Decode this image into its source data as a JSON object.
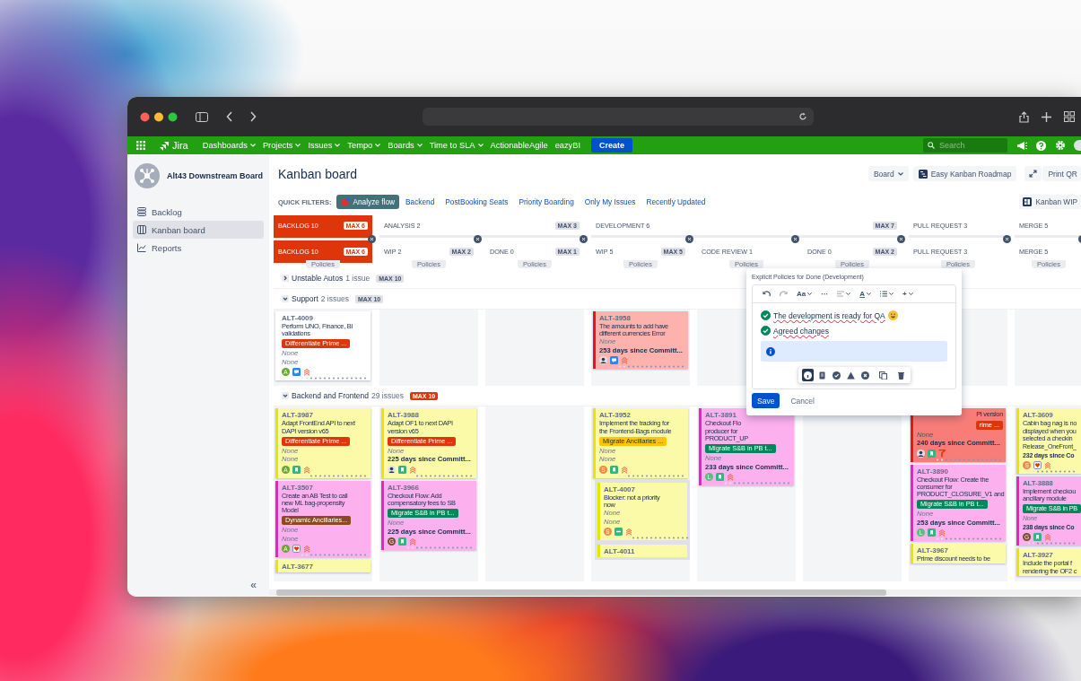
{
  "nav": {
    "logo": "Jira",
    "items": [
      {
        "label": "Dashboards",
        "dropdown": true
      },
      {
        "label": "Projects",
        "dropdown": true
      },
      {
        "label": "Issues",
        "dropdown": true
      },
      {
        "label": "Tempo",
        "dropdown": true
      },
      {
        "label": "Boards",
        "dropdown": true
      },
      {
        "label": "Time to SLA",
        "dropdown": true
      },
      {
        "label": "ActionableAgile",
        "dropdown": false
      },
      {
        "label": "eazyBI",
        "dropdown": false
      }
    ],
    "create": "Create",
    "search": {
      "placeholder": "Search"
    }
  },
  "sidebar": {
    "board_name": "Alt43 Downstream Board",
    "items": [
      {
        "label": "Backlog",
        "selected": false
      },
      {
        "label": "Kanban board",
        "selected": true
      },
      {
        "label": "Reports",
        "selected": false
      }
    ],
    "collapse": "«"
  },
  "header": {
    "title": "Kanban board",
    "buttons": [
      {
        "kind": "dropdown",
        "label": "Board"
      },
      {
        "kind": "roadmap",
        "label": "Easy Kanban Roadmap"
      },
      {
        "kind": "expand"
      },
      {
        "kind": "plain",
        "label": "Print QR"
      }
    ],
    "wip_button": "Kanban WIP"
  },
  "quick_filters": {
    "label": "QUICK FILTERS:",
    "items": [
      {
        "label": "Analyze flow",
        "icon": true,
        "selected": true
      },
      {
        "label": "Backend",
        "selected": false
      },
      {
        "label": "PostBooking Seats",
        "selected": false
      },
      {
        "label": "Priority Boarding",
        "selected": false
      },
      {
        "label": "Only My Issues",
        "selected": false
      },
      {
        "label": "Recently Updated",
        "selected": false
      }
    ]
  },
  "column_groups": [
    {
      "name": "BACKLOG 10",
      "max": "MAX 6",
      "over": true,
      "columns": [
        {
          "name": "BACKLOG 10",
          "max": "MAX 6",
          "over": true,
          "policies": "Policies"
        }
      ]
    },
    {
      "name": "ANALYSIS 2",
      "max": "MAX 3",
      "over": false,
      "columns": [
        {
          "name": "WIP 2",
          "max": "MAX 2",
          "over": false,
          "policies": "Policies"
        },
        {
          "name": "DONE 0",
          "max": "MAX 1",
          "over": false,
          "policies": "Policies"
        }
      ]
    },
    {
      "name": "DEVELOPMENT 6",
      "max": "MAX 7",
      "over": false,
      "columns": [
        {
          "name": "WIP 5",
          "max": "MAX 5",
          "over": false,
          "policies": "Policies"
        },
        {
          "name": "CODE REVIEW 1",
          "over": false,
          "policies": "Policies"
        },
        {
          "name": "DONE 0",
          "max": "MAX 2",
          "over": false,
          "policies": "Policies"
        }
      ]
    },
    {
      "name": "PULL REQUEST 3",
      "over": false,
      "columns": [
        {
          "name": "PULL REQUEST 3",
          "over": false,
          "policies": "Policies"
        }
      ]
    },
    {
      "name": "MERGE 5",
      "over": false,
      "columns": [
        {
          "name": "MERGE 5",
          "over": false,
          "policies": "Policies"
        }
      ]
    }
  ],
  "swimlanes": [
    {
      "title": "Unstable Autos",
      "count": "1 issue",
      "max": "MAX 10",
      "over": false,
      "expanded": false
    },
    {
      "title": "Support",
      "count": "2 issues",
      "max": "MAX 10",
      "over": false,
      "expanded": true,
      "cells": [
        {
          "cards": [
            {
              "id": "ALT-4009",
              "color": "#ffffff",
              "stripe": {
                "color": "#ffffff"
              },
              "summary": [
                "Perform UNO, Finance, BI",
                "validations"
              ],
              "epic": {
                "text": "Differentiate Prime ...",
                "color": "#de350b"
              },
              "fields": [
                {
                  "kind": "none",
                  "text": "None"
                },
                {
                  "kind": "none",
                  "text": "None"
                }
              ],
              "avatar": {
                "kind": "letter",
                "letter": "A",
                "color": "#6aa832"
              },
              "type": {
                "kind": "task"
              },
              "priority": {
                "kind": "highest"
              }
            }
          ]
        },
        {},
        {},
        {
          "cards": [
            {
              "id": "ALT-3958",
              "color": "#fdb2ad",
              "stripe": {
                "color": "#e8161b"
              },
              "summary": [
                "The amounts to add have",
                "different currencies Error"
              ],
              "fields": [
                {
                  "kind": "none",
                  "text": "None"
                },
                {
                  "kind": "days",
                  "text": "253 days since Committ..."
                }
              ],
              "avatar": {
                "kind": "photo"
              },
              "type": {
                "kind": "task"
              },
              "priority": {
                "kind": "highest"
              }
            }
          ]
        },
        {},
        {},
        {},
        {}
      ]
    },
    {
      "title": "Backend and Frontend",
      "count": "29 issues",
      "max": "MAX 10",
      "over": true,
      "expanded": true,
      "cells": [
        {
          "cards": [
            {
              "id": "ALT-3987",
              "color": "#fbfaa9",
              "stripe": {
                "color": "#e6e600"
              },
              "summary": [
                "Adapt FrontEnd API to next",
                "DAPI version v65"
              ],
              "epic": {
                "text": "Differentiate Prime ...",
                "color": "#de350b"
              },
              "fields": [
                {
                  "kind": "none",
                  "text": "None"
                },
                {
                  "kind": "none",
                  "text": "None"
                }
              ],
              "avatar": {
                "kind": "letter",
                "letter": "A",
                "color": "#6aa832"
              },
              "type": {
                "kind": "story"
              },
              "priority": {
                "kind": "highest"
              }
            },
            {
              "id": "ALT-3507",
              "color": "#fdb0ee",
              "stripe": {
                "color": "#ee1fc8"
              },
              "summary": [
                "Create an AB Test to call",
                "new ML bag-propensity",
                "Model"
              ],
              "epic": {
                "text": "Dynamic Ancillaries...",
                "color": "#8b4a1f"
              },
              "fields": [
                {
                  "kind": "none",
                  "text": "None"
                },
                {
                  "kind": "none",
                  "text": "None"
                }
              ],
              "avatar": {
                "kind": "letter",
                "letter": "A",
                "color": "#6aa832"
              },
              "type": {
                "kind": "bug"
              },
              "priority": {
                "kind": "highest"
              }
            },
            {
              "id": "ALT-3677",
              "color": "#fbfaa9",
              "stripe": {
                "color": "#e6e600"
              }
            }
          ]
        },
        {
          "cards": [
            {
              "id": "ALT-3988",
              "color": "#fbfaa9",
              "stripe": {
                "color": "#e6e600"
              },
              "summary": [
                "Adapt OF1 to next DAPI",
                "version v65"
              ],
              "epic": {
                "text": "Differentiate Prime ...",
                "color": "#de350b"
              },
              "fields": [
                {
                  "kind": "none",
                  "text": "None"
                },
                {
                  "kind": "days",
                  "text": "225 days since Committ..."
                }
              ],
              "avatar": {
                "kind": "photo"
              },
              "type": {
                "kind": "story"
              },
              "priority": {
                "kind": "highest"
              }
            },
            {
              "id": "ALT-3966",
              "color": "#fdb0ee",
              "stripe": {
                "color": "#ee1fc8"
              },
              "summary": [
                "Checkout Flow: Add",
                "compensatory fees to SB"
              ],
              "epic": {
                "text": "Migrate S&B in PB t...",
                "color": "#00875a"
              },
              "fields": [
                {
                  "kind": "none",
                  "text": "None"
                },
                {
                  "kind": "days",
                  "text": "225 days since Committ..."
                }
              ],
              "avatar": {
                "kind": "letter",
                "letter": "G",
                "color": "#7b4a2c"
              },
              "type": {
                "kind": "story"
              },
              "priority": {
                "kind": "highest"
              }
            }
          ]
        },
        {},
        {
          "cards": [
            {
              "id": "ALT-3952",
              "color": "#fbfaa9",
              "stripe": {
                "color": "#e6e600"
              },
              "summary": [
                "Implement the tracking for",
                "the Frontend-Bags module"
              ],
              "epic": {
                "text": "Migrate Ancillaries ...",
                "color": "#ffc400"
              },
              "fields": [
                {
                  "kind": "none",
                  "text": "None"
                },
                {
                  "kind": "none",
                  "text": "None"
                }
              ],
              "avatar": {
                "kind": "letter",
                "letter": "S",
                "color": "#f08a3c"
              },
              "type": {
                "kind": "story"
              },
              "priority": {
                "kind": "highest"
              }
            },
            {
              "id": "ALT-4007",
              "inset": true,
              "color": "#fbfaa9",
              "stripe": {
                "color": "#e6e600"
              },
              "summary": [
                "Blocker: not a priority",
                "now"
              ],
              "fields": [
                {
                  "kind": "none",
                  "text": "None"
                },
                {
                  "kind": "none",
                  "text": "None"
                }
              ],
              "avatar": {
                "kind": "letter",
                "letter": "S",
                "color": "#f08a3c"
              },
              "type": {
                "kind": "blocker"
              },
              "priority": {
                "kind": "highest"
              }
            },
            {
              "id": "ALT-4011",
              "inset": true,
              "color": "#fbfaa9",
              "stripe": {
                "color": "#e6e600"
              }
            }
          ]
        },
        {
          "cards": [
            {
              "id": "ALT-3891",
              "color": "#fdb0ee",
              "stripe": {
                "color": "#ee1fc8"
              },
              "summary": [
                "Checkout Flo",
                "producer for",
                "PRODUCT_UP"
              ],
              "epic": {
                "text": "Migrate S&B in PB t...",
                "color": "#00875a"
              },
              "fields": [
                {
                  "kind": "none",
                  "text": "None"
                },
                {
                  "kind": "days",
                  "text": "233 days since Committ..."
                }
              ],
              "avatar": {
                "kind": "letter",
                "letter": "L",
                "color": "#5bbf7a"
              },
              "type": {
                "kind": "story"
              },
              "priority": {
                "kind": "highest"
              }
            }
          ]
        },
        {},
        {
          "cards": [
            {
              "covered": true,
              "color": "#f87d78",
              "stripe": {
                "color": "#e8161b"
              },
              "summary": [
                "PI version"
              ],
              "epic": {
                "text": "rime ...",
                "color": "#de350b"
              },
              "fields": [
                {
                  "kind": "none",
                  "text": "None"
                },
                {
                  "kind": "days",
                  "text": "240 days since Committ..."
                }
              ],
              "avatar": {
                "kind": "photo"
              },
              "type": {
                "kind": "story"
              },
              "priority": {
                "kind": "flag"
              }
            },
            {
              "id": "ALT-3890",
              "color": "#fdb0ee",
              "stripe": {
                "color": "#ee1fc8"
              },
              "summary": [
                "Checkout Flow: Create the",
                "consumer for",
                "PRODUCT_CLOSURE_V1 and"
              ],
              "epic": {
                "text": "Migrate S&B in PB t...",
                "color": "#00875a"
              },
              "fields": [
                {
                  "kind": "none",
                  "text": "None"
                },
                {
                  "kind": "days",
                  "text": "253 days since Committ..."
                }
              ],
              "avatar": {
                "kind": "letter",
                "letter": "L",
                "color": "#5bbf7a"
              },
              "type": {
                "kind": "story"
              },
              "priority": {
                "kind": "highest"
              }
            },
            {
              "id": "ALT-3967",
              "color": "#fbfaa9",
              "stripe": {
                "color": "#e6e600"
              },
              "summary": [
                "Prime discount needs to be"
              ]
            }
          ]
        },
        {
          "cards": [
            {
              "id": "ALT-3609",
              "color": "#fbfaa9",
              "stripe": {
                "color": "#e6e600"
              },
              "summary": [
                "Cabin bag nag is no",
                "displayed when you",
                "selected a checkin"
              ],
              "fields": [
                {
                  "kind": "plain",
                  "text": "Release_OneFront_"
                },
                {
                  "kind": "days",
                  "text": "232 days since Co"
                }
              ],
              "avatar": {
                "kind": "letter",
                "letter": "S",
                "color": "#f08a3c"
              },
              "type": {
                "kind": "bug"
              },
              "priority": {
                "kind": "highest"
              }
            },
            {
              "id": "ALT-3888",
              "color": "#fdb0ee",
              "stripe": {
                "color": "#ee1fc8"
              },
              "summary": [
                "Implement checkou",
                "ancillary module"
              ],
              "epic": {
                "text": "Migrate S&B in PB",
                "color": "#00875a"
              },
              "fields": [
                {
                  "kind": "none",
                  "text": "None"
                },
                {
                  "kind": "days",
                  "text": "238 days since Co"
                }
              ],
              "avatar": {
                "kind": "letter",
                "letter": "G",
                "color": "#7b4a2c"
              },
              "type": {
                "kind": "story"
              },
              "priority": {
                "kind": "highest"
              }
            },
            {
              "id": "ALT-3927",
              "color": "#fbfaa9",
              "stripe": {
                "color": "#e6e600"
              },
              "summary": [
                "Include the portal f",
                "rendering the OF2 c"
              ]
            }
          ]
        }
      ]
    }
  ],
  "policy_editor": {
    "title": "Explicit Policies for Done (Development)",
    "toolbar": [
      {
        "kind": "undo",
        "caret": false
      },
      {
        "kind": "redo",
        "caret": false
      },
      {
        "kind": "text",
        "label": "Aa",
        "caret": true
      },
      {
        "kind": "text",
        "label": "···",
        "caret": false
      },
      {
        "kind": "align",
        "caret": true
      },
      {
        "kind": "color",
        "label": "A",
        "caret": true
      },
      {
        "kind": "list",
        "caret": true
      },
      {
        "kind": "text",
        "label": "+",
        "caret": true
      }
    ],
    "items": [
      {
        "text": "The development is ready for QA",
        "emoji": true,
        "checked": true
      },
      {
        "text": "Agreed changes",
        "emoji": false,
        "checked": true
      }
    ],
    "panel_tools": [
      {
        "kind": "info",
        "selected": true
      },
      {
        "kind": "note",
        "selected": false
      },
      {
        "kind": "success",
        "selected": false
      },
      {
        "kind": "warning",
        "selected": false
      },
      {
        "kind": "error",
        "selected": false
      },
      {
        "kind": "copy",
        "selected": false
      },
      {
        "kind": "delete",
        "selected": false
      }
    ],
    "save": "Save",
    "cancel": "Cancel"
  }
}
